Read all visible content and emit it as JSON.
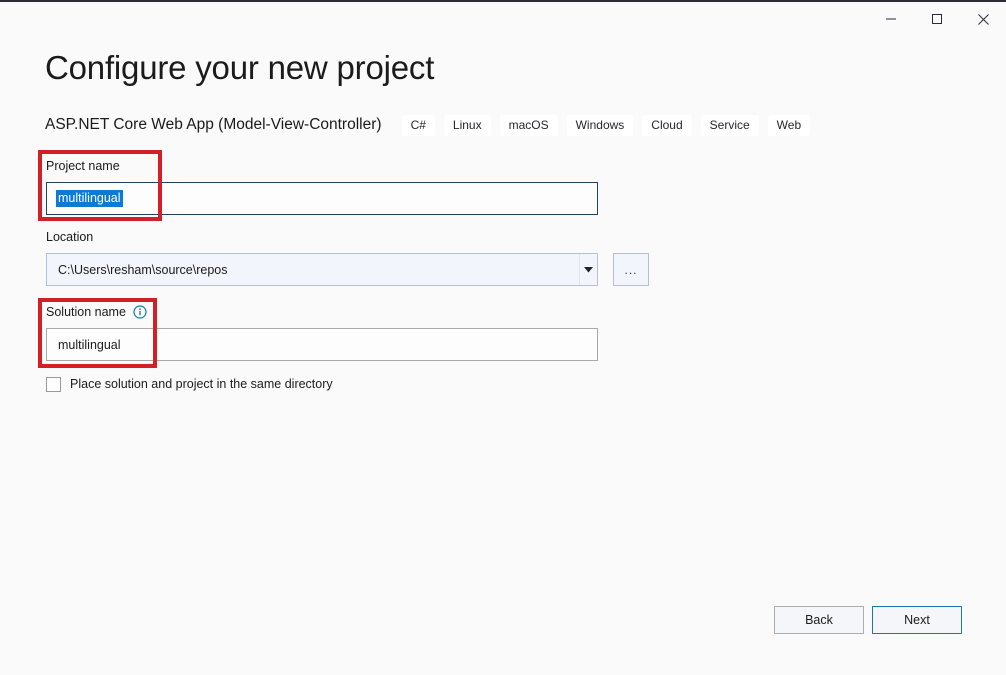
{
  "window": {
    "controls": {
      "minimize_label": "Minimize",
      "maximize_label": "Maximize",
      "close_label": "Close"
    }
  },
  "header": {
    "title": "Configure your new project",
    "template_name": "ASP.NET Core Web App (Model-View-Controller)",
    "tags": [
      "C#",
      "Linux",
      "macOS",
      "Windows",
      "Cloud",
      "Service",
      "Web"
    ]
  },
  "form": {
    "project_name": {
      "label": "Project name",
      "value": "multilingual",
      "selected": true
    },
    "location": {
      "label": "Location",
      "value": "C:\\Users\\resham\\source\\repos",
      "browse_label": "..."
    },
    "solution_name": {
      "label": "Solution name",
      "value": "multilingual",
      "info_icon": "info-icon"
    },
    "same_directory_checkbox": {
      "label": "Place solution and project in the same directory",
      "checked": false
    }
  },
  "footer": {
    "back_label": "Back",
    "next_label": "Next"
  },
  "annotations": {
    "highlight_color": "#d31f26",
    "boxes": [
      "project-name",
      "solution-name"
    ]
  },
  "colors": {
    "background": "#fafafa",
    "accent": "#1a7aa8",
    "selection": "#0d7bd4",
    "info": "#1277a8",
    "annotation": "#d31f26"
  }
}
